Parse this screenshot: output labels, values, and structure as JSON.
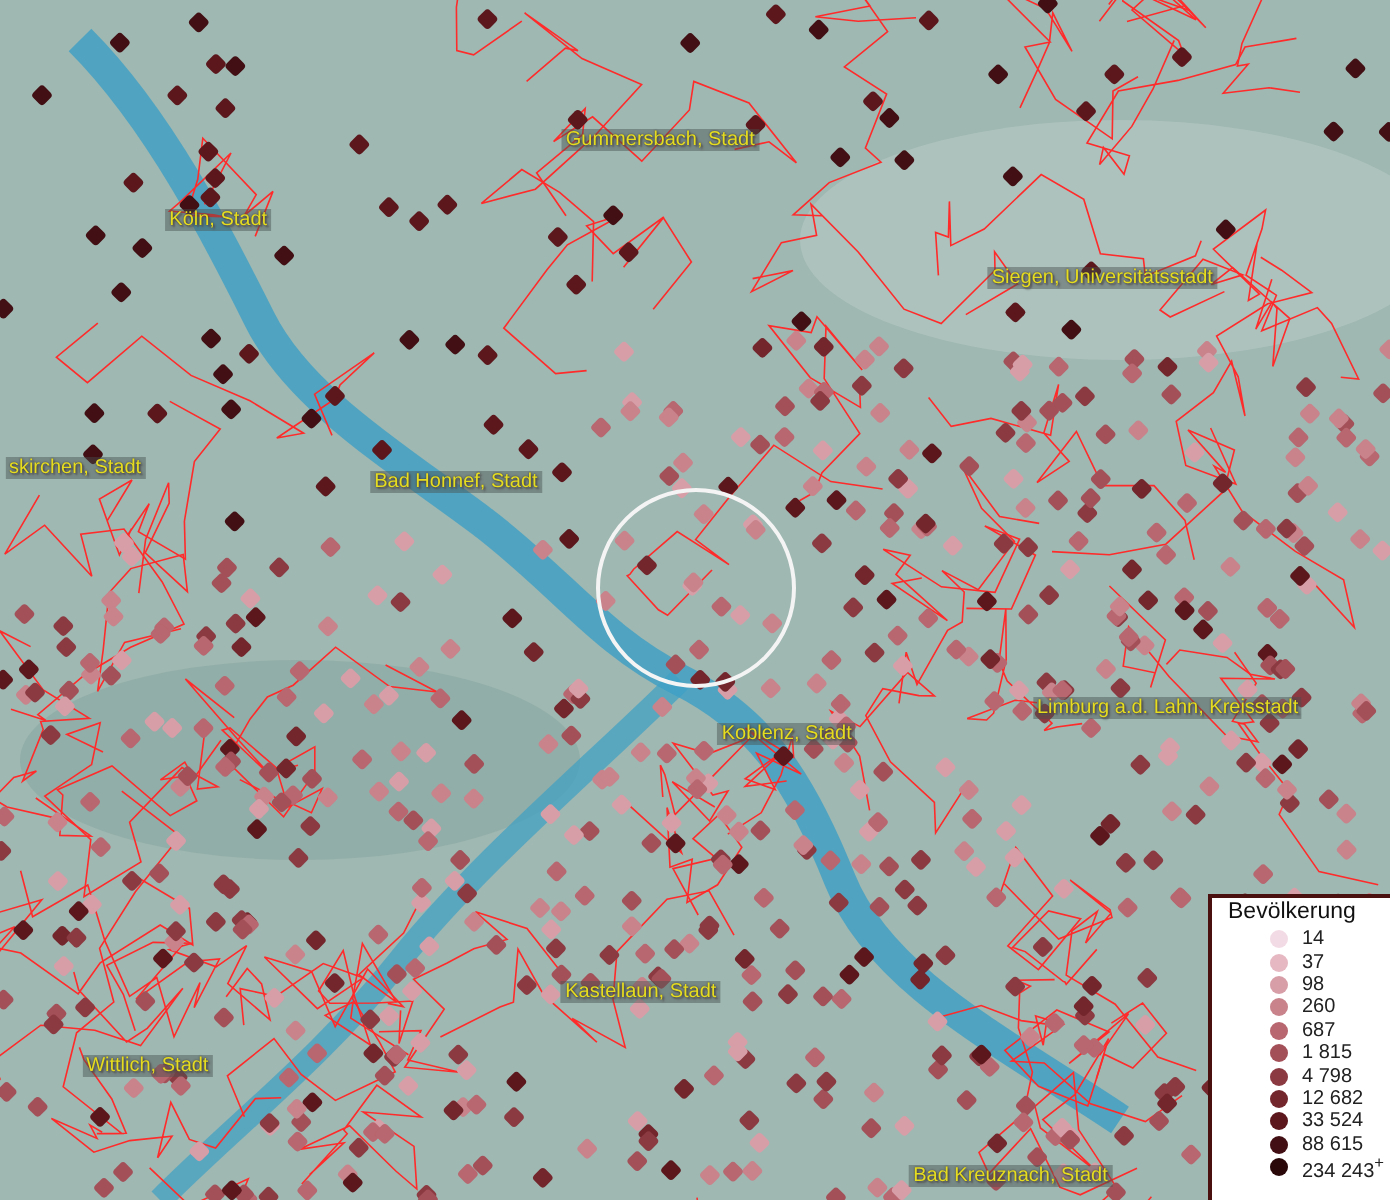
{
  "map": {
    "labels": [
      "Gummersbach, Stadt",
      "Köln, Stadt",
      "Siegen, Universitätsstadt",
      "skirchen, Stadt",
      "Bad Honnef, Stadt",
      "Limburg a.d. Lahn, Kreisstadt",
      "Koblenz, Stadt",
      "Kastellaun, Stadt",
      "Wittlich, Stadt",
      "Bad Kreuznach, Stadt"
    ]
  },
  "legend": {
    "title": "Bevölkerung",
    "items": [
      {
        "label": "14",
        "color": "#f3dbe5"
      },
      {
        "label": "37",
        "color": "#e5b8c2"
      },
      {
        "label": "98",
        "color": "#d79ea8"
      },
      {
        "label": "260",
        "color": "#c8838b"
      },
      {
        "label": "687",
        "color": "#b8666f"
      },
      {
        "label": "1 815",
        "color": "#a45059"
      },
      {
        "label": "4 798",
        "color": "#8c3a42"
      },
      {
        "label": "12 682",
        "color": "#74262d"
      },
      {
        "label": "33 524",
        "color": "#5c171d"
      },
      {
        "label": "88 615",
        "color": "#421014"
      },
      {
        "label": "234 243$^{+}$",
        "color": "#2a080a"
      }
    ]
  }
}
